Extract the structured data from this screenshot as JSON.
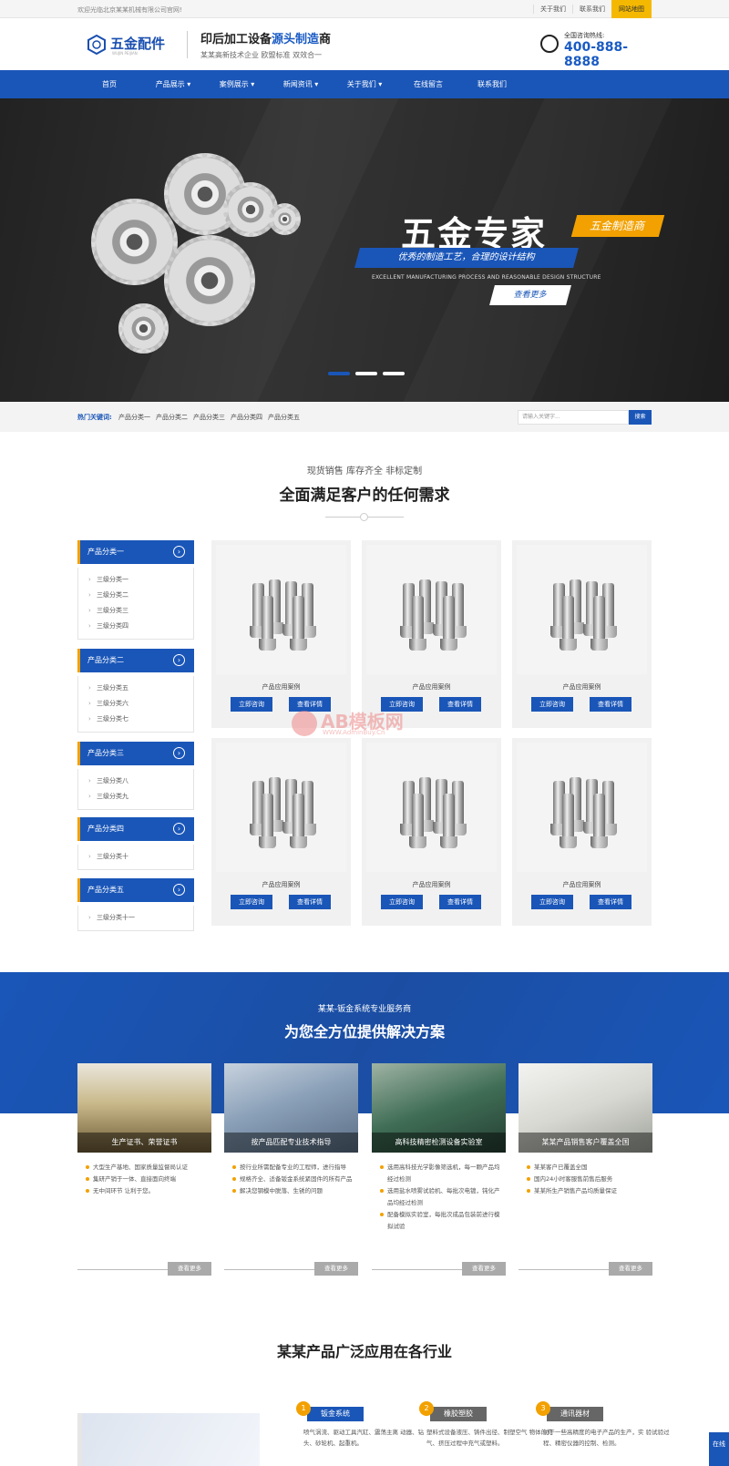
{
  "topbar": {
    "welcome": "欢迎光临北京某某机械有限公司官网!",
    "links": [
      "关于我们",
      "联系我们"
    ],
    "sitemap": "网站地图"
  },
  "header": {
    "logo_text": "五金配件",
    "logo_sub": "WUJIN PEIJIAN",
    "slogan_main_a": "印后加工设备",
    "slogan_main_b": "源头制造",
    "slogan_main_c": "商",
    "slogan_sub": "某某高新技术企业 欧盟标准 双效合一",
    "hotline_label": "全国咨询热线:",
    "hotline_number": "400-888-8888"
  },
  "nav": [
    "首页",
    "产品展示 ▾",
    "案例展示 ▾",
    "新闻资讯 ▾",
    "关于我们 ▾",
    "在线留言",
    "联系我们"
  ],
  "banner": {
    "title": "五金专家",
    "tag": "五金制造商",
    "subtitle": "优秀的制造工艺，合理的设计结构",
    "english": "EXCELLENT MANUFACTURING PROCESS AND REASONABLE DESIGN STRUCTURE",
    "button": "查看更多"
  },
  "hot": {
    "label": "热门关键词:",
    "keywords": [
      "产品分类一",
      "产品分类二",
      "产品分类三",
      "产品分类四",
      "产品分类五"
    ],
    "search_placeholder": "请输入关键字...",
    "search_button": "搜索"
  },
  "section_products": {
    "sub": "现货销售 库存齐全 非标定制",
    "title": "全面满足客户的任何需求"
  },
  "categories": [
    {
      "title": "产品分类一",
      "items": [
        "三级分类一",
        "三级分类二",
        "三级分类三",
        "三级分类四"
      ]
    },
    {
      "title": "产品分类二",
      "items": [
        "三级分类五",
        "三级分类六",
        "三级分类七"
      ]
    },
    {
      "title": "产品分类三",
      "items": [
        "三级分类八",
        "三级分类九"
      ]
    },
    {
      "title": "产品分类四",
      "items": [
        "三级分类十"
      ]
    },
    {
      "title": "产品分类五",
      "items": [
        "三级分类十一"
      ]
    }
  ],
  "products": {
    "name": "产品应用案例",
    "btn_consult": "立即咨询",
    "btn_detail": "查看详情"
  },
  "watermark": {
    "text": "AB模板网",
    "url": "WWW.AdminBuy.Cn"
  },
  "solutions": {
    "sub": "某某-钣金系统专业服务商",
    "title": "为您全方位提供解决方案",
    "more": "查看更多",
    "cards": [
      {
        "caption": "生产证书、荣誉证书",
        "bullets": [
          "大型生产基地、国家质量监督局认证",
          "集研产销于一体、直接面向终端",
          "无中间环节 让利于您。"
        ]
      },
      {
        "caption": "按产品匹配专业技术指导",
        "bullets": [
          "按行业所需配备专业的工程师，进行指导",
          "规格齐全、适备钣金系统紧固件的所有产品",
          "解决您钢模中脱落、生锈的问题"
        ]
      },
      {
        "caption": "高科技精密检测设备实验室",
        "bullets": [
          "选用高科技光学影像筛选机，每一颗产品均经过检测",
          "选用盐水喷雾试验机、每批次电镀，钝化产品均经过检测",
          "配备模拟实验室，每批次成品包装前进行模拟试验"
        ]
      },
      {
        "caption": "某某产品销售客户覆盖全国",
        "bullets": [
          "某某客户已覆盖全国",
          "国内24小时客服售前售后服务",
          "某某所生产销售产品均质量保证"
        ]
      }
    ]
  },
  "industries": {
    "title": "某某产品广泛应用在各行业",
    "items": [
      {
        "num": "1",
        "tag": "钣金系统",
        "text": "喷气涡流、驱动工具汽缸、震荡主离 动器、钻头、砂轮机、起重机。",
        "color": "#1a56b8"
      },
      {
        "num": "2",
        "tag": "橡胶塑胶",
        "text": "塑料式设备液压、铸件出径、制塑空气 物体的充气、挤压过程中充气或塑料。",
        "color": "#666666"
      },
      {
        "num": "3",
        "tag": "通讯器材",
        "text": "对于一些高精度的电子产品的生产，实 验试验过程、精密仪器的控制、检测。",
        "color": "#666666"
      }
    ]
  },
  "float_btn": "在线"
}
